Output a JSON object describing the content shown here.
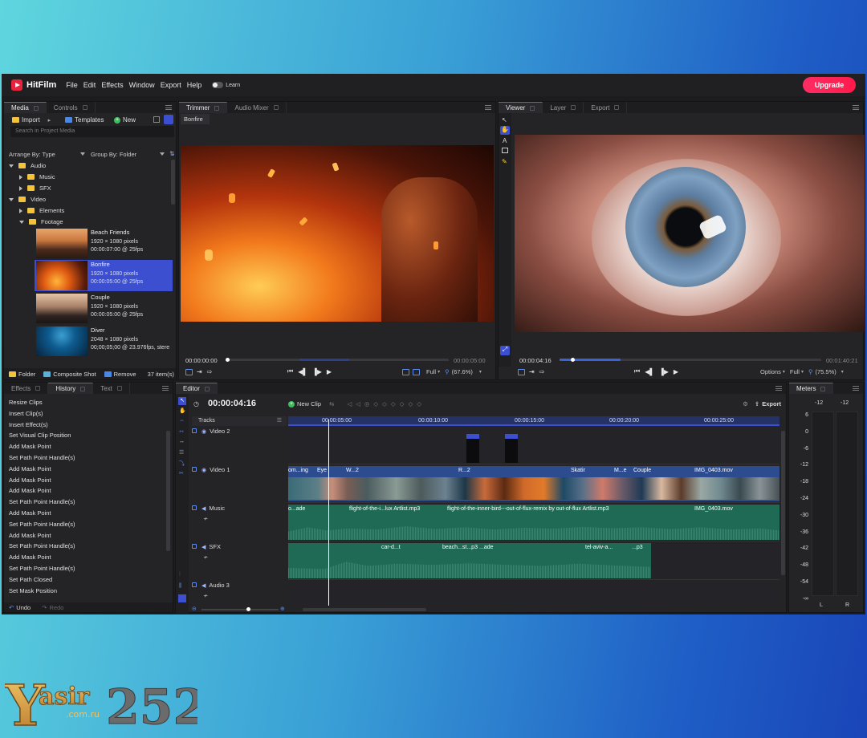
{
  "app": {
    "name": "HitFilm",
    "upgrade_label": "Upgrade",
    "learn_label": "Learn"
  },
  "menu": [
    "File",
    "Edit",
    "Effects",
    "Window",
    "Export",
    "Help"
  ],
  "media_panel": {
    "tabs": [
      "Media",
      "Controls"
    ],
    "import_label": "Import",
    "templates_label": "Templates",
    "new_label": "New",
    "search_placeholder": "Search in Project Media",
    "arrange_by": "Arrange By: Type",
    "group_by": "Group By: Folder",
    "tree": [
      {
        "label": "Audio",
        "level": 0,
        "expanded": true
      },
      {
        "label": "Music",
        "level": 1,
        "expanded": false
      },
      {
        "label": "SFX",
        "level": 1,
        "expanded": false
      },
      {
        "label": "Video",
        "level": 0,
        "expanded": true
      },
      {
        "label": "Elements",
        "level": 1,
        "expanded": false
      },
      {
        "label": "Footage",
        "level": 1,
        "expanded": true
      }
    ],
    "items": [
      {
        "name": "Beach Friends",
        "res": "1920 × 1080 pixels",
        "dur": "00:00:07:00 @ 25fps"
      },
      {
        "name": "Bonfire",
        "res": "1920 × 1080 pixels",
        "dur": "00:00:05:00 @ 25fps"
      },
      {
        "name": "Couple",
        "res": "1920 × 1080 pixels",
        "dur": "00:00:05:00 @ 25fps"
      },
      {
        "name": "Diver",
        "res": "2048 × 1080 pixels",
        "dur": "00;00;05;00 @ 23.976fps, stere"
      }
    ],
    "footer": {
      "folder": "Folder",
      "composite": "Composite Shot",
      "remove": "Remove",
      "count": "37 item(s)"
    }
  },
  "trimmer": {
    "tabs": [
      "Trimmer",
      "Audio Mixer"
    ],
    "clip_name": "Bonfire",
    "time_current": "00:00:00:00",
    "time_end": "00:00:05:00",
    "quality": "Full",
    "zoom": "(67.6%)"
  },
  "viewer": {
    "tabs": [
      "Viewer",
      "Layer",
      "Export"
    ],
    "time_current": "00:00:04:16",
    "time_end": "00:01:40:21",
    "options_label": "Options",
    "quality": "Full",
    "zoom": "(75.5%)"
  },
  "history_panel": {
    "tabs": [
      "Effects",
      "History",
      "Text"
    ],
    "items": [
      "Resize Clips",
      "Insert Clip(s)",
      "Insert Effect(s)",
      "Set Visual Clip Position",
      "Add Mask Point",
      "Set Path Point Handle(s)",
      "Add Mask Point",
      "Add Mask Point",
      "Add Mask Point",
      "Set Path Point Handle(s)",
      "Add Mask Point",
      "Set Path Point Handle(s)",
      "Add Mask Point",
      "Set Path Point Handle(s)",
      "Add Mask Point",
      "Set Path Point Handle(s)",
      "Set Path Closed",
      "Set Mask Position"
    ],
    "undo_label": "Undo",
    "redo_label": "Redo"
  },
  "editor": {
    "tab": "Editor",
    "timecode": "00:00:04:16",
    "new_clip_label": "New Clip",
    "export_label": "Export",
    "tracks_label": "Tracks",
    "ruler": [
      "00:00:05:00",
      "00:00:10:00",
      "00:00:15:00",
      "00:00:20:00",
      "00:00:25:00"
    ],
    "tracks": [
      {
        "name": "Video 2",
        "kind": "video"
      },
      {
        "name": "Video 1",
        "kind": "video"
      },
      {
        "name": "Music",
        "kind": "audio"
      },
      {
        "name": "SFX",
        "kind": "audio"
      },
      {
        "name": "Audio 3",
        "kind": "audio"
      }
    ],
    "video1_labels": [
      "om...ing",
      "Eye",
      "W...2",
      "R...2",
      "Skatir",
      "M...e",
      "Couple",
      "IMG_0403.mov"
    ],
    "music_labels": [
      "o...ade",
      "flight-of-the-i...lux Artlist.mp3",
      "flight-of-the-inner-bird---out-of-flux-remix by out-of-flux Artlist.mp3",
      "IMG_0403.mov"
    ],
    "sfx_labels": [
      "car-d...t",
      "beach...st...p3",
      "...ade",
      "tel-aviv-a...",
      "...p3"
    ]
  },
  "meters": {
    "tab": "Meters",
    "peak_l": "-12",
    "peak_r": "-12",
    "scale": [
      "6",
      "0",
      "-6",
      "-12",
      "-18",
      "-24",
      "-30",
      "-36",
      "-42",
      "-48",
      "-54",
      "-∞"
    ],
    "channels": [
      "L",
      "R"
    ]
  },
  "watermark": {
    "text": "Yasir252",
    "sub": ".com.ru"
  },
  "colors": {
    "accent": "#3b4fd0",
    "upgrade": "#ff2d64",
    "clip_video": "#2d4c8f",
    "clip_audio": "#1f6a55"
  }
}
